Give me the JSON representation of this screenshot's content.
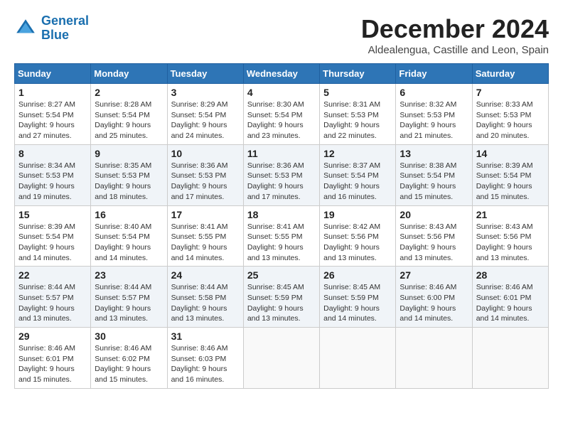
{
  "header": {
    "logo_line1": "General",
    "logo_line2": "Blue",
    "month": "December 2024",
    "location": "Aldealengua, Castille and Leon, Spain"
  },
  "calendar": {
    "days_of_week": [
      "Sunday",
      "Monday",
      "Tuesday",
      "Wednesday",
      "Thursday",
      "Friday",
      "Saturday"
    ],
    "weeks": [
      [
        {
          "day": "",
          "empty": true
        },
        {
          "day": "",
          "empty": true
        },
        {
          "day": "",
          "empty": true
        },
        {
          "day": "",
          "empty": true
        },
        {
          "day": "",
          "empty": true
        },
        {
          "day": "",
          "empty": true
        },
        {
          "day": "",
          "empty": true
        }
      ],
      [
        {
          "day": "1",
          "sunrise": "Sunrise: 8:27 AM",
          "sunset": "Sunset: 5:54 PM",
          "daylight": "Daylight: 9 hours and 27 minutes."
        },
        {
          "day": "2",
          "sunrise": "Sunrise: 8:28 AM",
          "sunset": "Sunset: 5:54 PM",
          "daylight": "Daylight: 9 hours and 25 minutes."
        },
        {
          "day": "3",
          "sunrise": "Sunrise: 8:29 AM",
          "sunset": "Sunset: 5:54 PM",
          "daylight": "Daylight: 9 hours and 24 minutes."
        },
        {
          "day": "4",
          "sunrise": "Sunrise: 8:30 AM",
          "sunset": "Sunset: 5:54 PM",
          "daylight": "Daylight: 9 hours and 23 minutes."
        },
        {
          "day": "5",
          "sunrise": "Sunrise: 8:31 AM",
          "sunset": "Sunset: 5:53 PM",
          "daylight": "Daylight: 9 hours and 22 minutes."
        },
        {
          "day": "6",
          "sunrise": "Sunrise: 8:32 AM",
          "sunset": "Sunset: 5:53 PM",
          "daylight": "Daylight: 9 hours and 21 minutes."
        },
        {
          "day": "7",
          "sunrise": "Sunrise: 8:33 AM",
          "sunset": "Sunset: 5:53 PM",
          "daylight": "Daylight: 9 hours and 20 minutes."
        }
      ],
      [
        {
          "day": "8",
          "sunrise": "Sunrise: 8:34 AM",
          "sunset": "Sunset: 5:53 PM",
          "daylight": "Daylight: 9 hours and 19 minutes."
        },
        {
          "day": "9",
          "sunrise": "Sunrise: 8:35 AM",
          "sunset": "Sunset: 5:53 PM",
          "daylight": "Daylight: 9 hours and 18 minutes."
        },
        {
          "day": "10",
          "sunrise": "Sunrise: 8:36 AM",
          "sunset": "Sunset: 5:53 PM",
          "daylight": "Daylight: 9 hours and 17 minutes."
        },
        {
          "day": "11",
          "sunrise": "Sunrise: 8:36 AM",
          "sunset": "Sunset: 5:53 PM",
          "daylight": "Daylight: 9 hours and 17 minutes."
        },
        {
          "day": "12",
          "sunrise": "Sunrise: 8:37 AM",
          "sunset": "Sunset: 5:54 PM",
          "daylight": "Daylight: 9 hours and 16 minutes."
        },
        {
          "day": "13",
          "sunrise": "Sunrise: 8:38 AM",
          "sunset": "Sunset: 5:54 PM",
          "daylight": "Daylight: 9 hours and 15 minutes."
        },
        {
          "day": "14",
          "sunrise": "Sunrise: 8:39 AM",
          "sunset": "Sunset: 5:54 PM",
          "daylight": "Daylight: 9 hours and 15 minutes."
        }
      ],
      [
        {
          "day": "15",
          "sunrise": "Sunrise: 8:39 AM",
          "sunset": "Sunset: 5:54 PM",
          "daylight": "Daylight: 9 hours and 14 minutes."
        },
        {
          "day": "16",
          "sunrise": "Sunrise: 8:40 AM",
          "sunset": "Sunset: 5:54 PM",
          "daylight": "Daylight: 9 hours and 14 minutes."
        },
        {
          "day": "17",
          "sunrise": "Sunrise: 8:41 AM",
          "sunset": "Sunset: 5:55 PM",
          "daylight": "Daylight: 9 hours and 14 minutes."
        },
        {
          "day": "18",
          "sunrise": "Sunrise: 8:41 AM",
          "sunset": "Sunset: 5:55 PM",
          "daylight": "Daylight: 9 hours and 13 minutes."
        },
        {
          "day": "19",
          "sunrise": "Sunrise: 8:42 AM",
          "sunset": "Sunset: 5:56 PM",
          "daylight": "Daylight: 9 hours and 13 minutes."
        },
        {
          "day": "20",
          "sunrise": "Sunrise: 8:43 AM",
          "sunset": "Sunset: 5:56 PM",
          "daylight": "Daylight: 9 hours and 13 minutes."
        },
        {
          "day": "21",
          "sunrise": "Sunrise: 8:43 AM",
          "sunset": "Sunset: 5:56 PM",
          "daylight": "Daylight: 9 hours and 13 minutes."
        }
      ],
      [
        {
          "day": "22",
          "sunrise": "Sunrise: 8:44 AM",
          "sunset": "Sunset: 5:57 PM",
          "daylight": "Daylight: 9 hours and 13 minutes."
        },
        {
          "day": "23",
          "sunrise": "Sunrise: 8:44 AM",
          "sunset": "Sunset: 5:57 PM",
          "daylight": "Daylight: 9 hours and 13 minutes."
        },
        {
          "day": "24",
          "sunrise": "Sunrise: 8:44 AM",
          "sunset": "Sunset: 5:58 PM",
          "daylight": "Daylight: 9 hours and 13 minutes."
        },
        {
          "day": "25",
          "sunrise": "Sunrise: 8:45 AM",
          "sunset": "Sunset: 5:59 PM",
          "daylight": "Daylight: 9 hours and 13 minutes."
        },
        {
          "day": "26",
          "sunrise": "Sunrise: 8:45 AM",
          "sunset": "Sunset: 5:59 PM",
          "daylight": "Daylight: 9 hours and 14 minutes."
        },
        {
          "day": "27",
          "sunrise": "Sunrise: 8:46 AM",
          "sunset": "Sunset: 6:00 PM",
          "daylight": "Daylight: 9 hours and 14 minutes."
        },
        {
          "day": "28",
          "sunrise": "Sunrise: 8:46 AM",
          "sunset": "Sunset: 6:01 PM",
          "daylight": "Daylight: 9 hours and 14 minutes."
        }
      ],
      [
        {
          "day": "29",
          "sunrise": "Sunrise: 8:46 AM",
          "sunset": "Sunset: 6:01 PM",
          "daylight": "Daylight: 9 hours and 15 minutes."
        },
        {
          "day": "30",
          "sunrise": "Sunrise: 8:46 AM",
          "sunset": "Sunset: 6:02 PM",
          "daylight": "Daylight: 9 hours and 15 minutes."
        },
        {
          "day": "31",
          "sunrise": "Sunrise: 8:46 AM",
          "sunset": "Sunset: 6:03 PM",
          "daylight": "Daylight: 9 hours and 16 minutes."
        },
        {
          "day": "",
          "empty": true
        },
        {
          "day": "",
          "empty": true
        },
        {
          "day": "",
          "empty": true
        },
        {
          "day": "",
          "empty": true
        }
      ]
    ]
  }
}
